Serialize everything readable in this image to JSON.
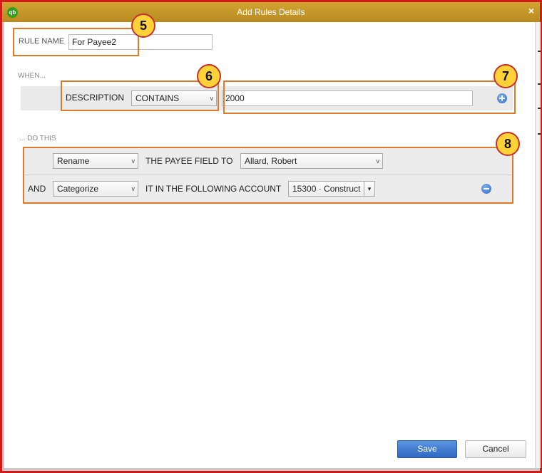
{
  "window": {
    "title": "Add Rules Details",
    "logo_text": "qb",
    "close_glyph": "×"
  },
  "rule_name": {
    "label": "RULE NAME",
    "value": "For Payee2"
  },
  "when": {
    "heading": "WHEN...",
    "field_label": "DESCRIPTION",
    "operator": "CONTAINS",
    "value": "2000"
  },
  "do_this": {
    "heading": "... DO THIS",
    "rows": [
      {
        "prefix": "",
        "action": "Rename",
        "text": "THE PAYEE FIELD TO",
        "target": "Allard, Robert"
      },
      {
        "prefix": "AND",
        "action": "Categorize",
        "text": "IT IN THE FOLLOWING ACCOUNT",
        "target": "15300 · Construct"
      }
    ]
  },
  "buttons": {
    "save": "Save",
    "cancel": "Cancel"
  },
  "annotations": {
    "b5": "5",
    "b6": "6",
    "b7": "7",
    "b8": "8"
  },
  "icons": {
    "add": "plus-circle-icon",
    "remove": "minus-circle-icon",
    "dropdown": "chevron-down-icon"
  },
  "colors": {
    "titlebar": "#c39a2c",
    "frame": "#d11a1a",
    "annotation_border": "#e07a2a",
    "badge": "#ffd23a",
    "save_button": "#3b78d0"
  }
}
